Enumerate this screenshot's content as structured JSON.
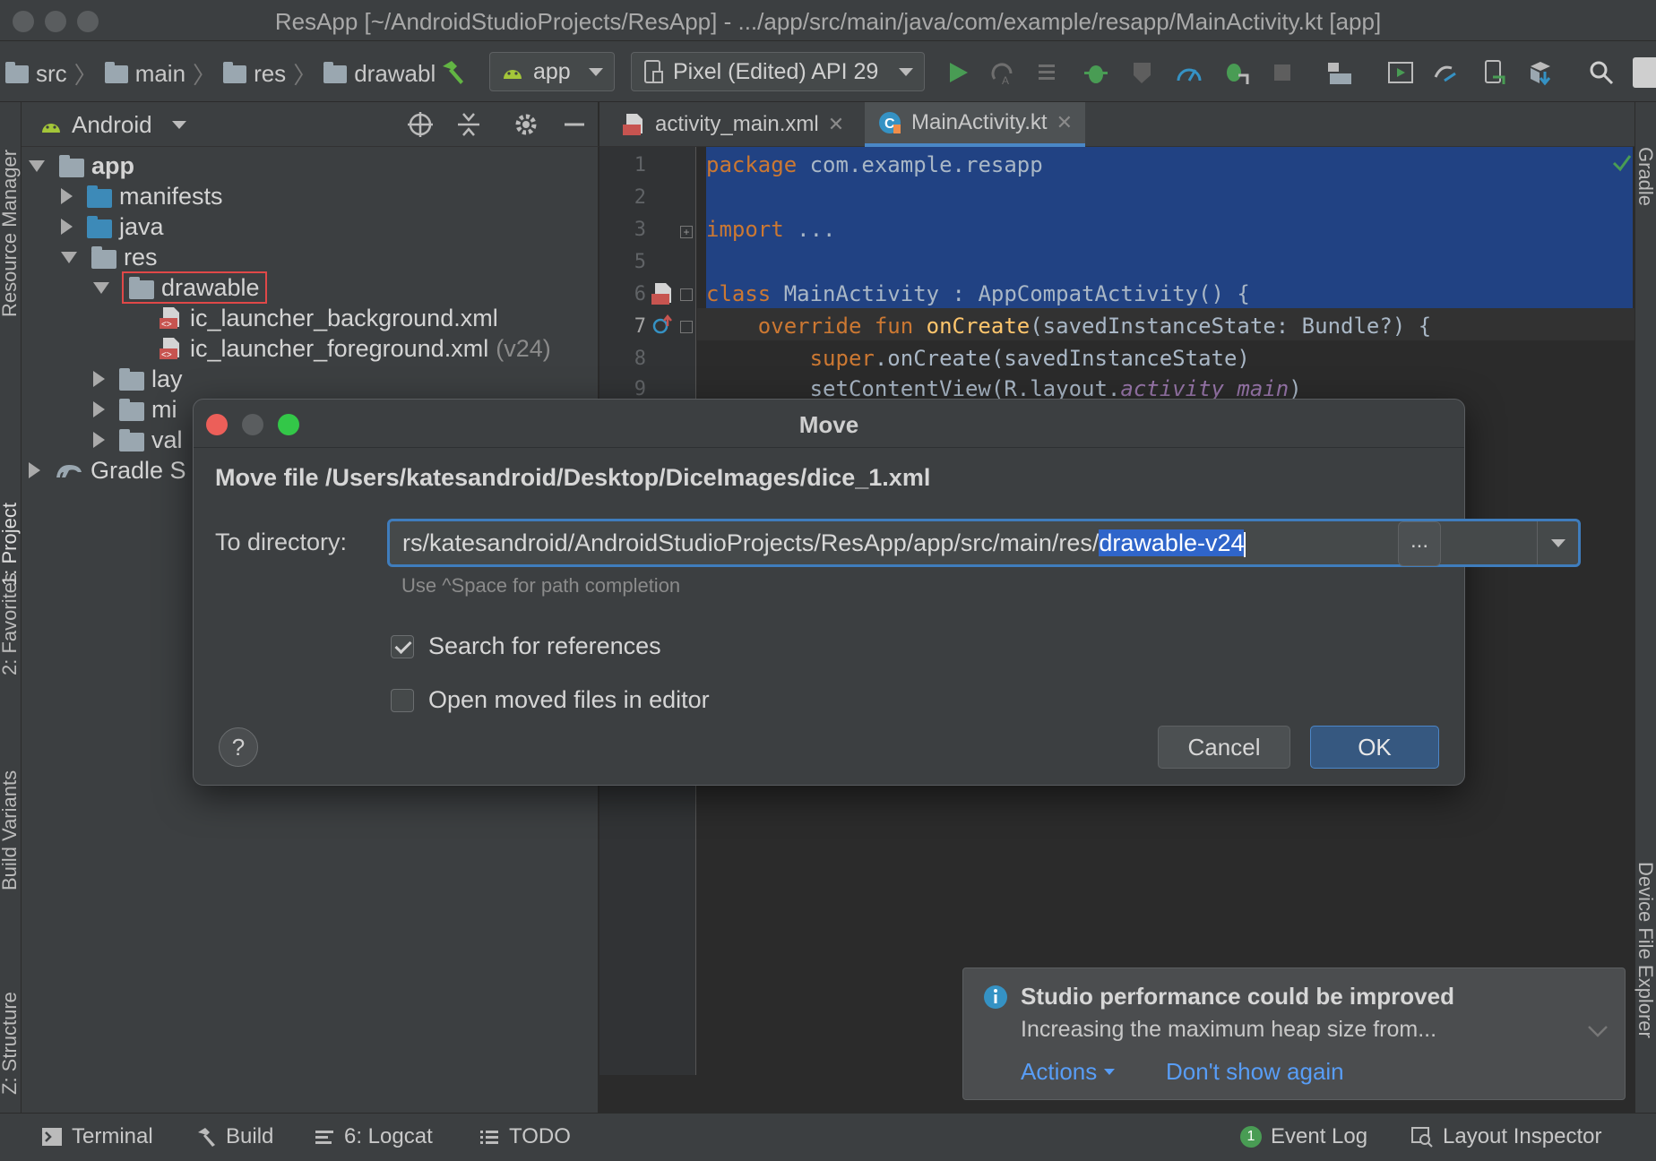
{
  "window": {
    "title": "ResApp [~/AndroidStudioProjects/ResApp] - .../app/src/main/java/com/example/resapp/MainActivity.kt [app]"
  },
  "toolbar": {
    "breadcrumbs": [
      "src",
      "main",
      "res",
      "drawabl"
    ],
    "run_config": "app",
    "device": "Pixel (Edited) API 29"
  },
  "left_strip": [
    "Resource Manager",
    "1: Project",
    "2: Favorites",
    "Build Variants",
    "Z: Structure"
  ],
  "right_strip": [
    "Gradle",
    "Device File Explorer"
  ],
  "project_panel": {
    "view": "Android",
    "tree": {
      "app": "app",
      "manifests": "manifests",
      "java": "java",
      "res": "res",
      "drawable": "drawable",
      "file1": "ic_launcher_background.xml",
      "file2": "ic_launcher_foreground.xml",
      "file2_suffix": "(v24)",
      "layout": "lay",
      "mipmap": "mi",
      "values": "val",
      "gradle": "Gradle S"
    }
  },
  "editor": {
    "tabs": [
      {
        "label": "activity_main.xml"
      },
      {
        "label": "MainActivity.kt"
      }
    ],
    "line_numbers": [
      "1",
      "2",
      "3",
      "5",
      "6",
      "7",
      "8",
      "9"
    ],
    "code": {
      "l1_kw": "package",
      "l1_rest": " com.example.resapp",
      "l3_kw": "import",
      "l3_rest": " ...",
      "l6_kw": "class",
      "l6_rest": " MainActivity : AppCompatActivity() {",
      "l7_kw1": "    override fun",
      "l7_fn": " onCreate",
      "l7_rest": "(savedInstanceState: Bundle?) {",
      "l8_kw": "        super",
      "l8_rest": ".onCreate(savedInstanceState)",
      "l9_a": "        setContentView(R.layout.",
      "l9_it": "activity_main",
      "l9_b": ")"
    }
  },
  "dialog": {
    "title": "Move",
    "message": "Move file /Users/katesandroid/Desktop/DiceImages/dice_1.xml",
    "dir_label": "To directory:",
    "dir_value_plain": "rs/katesandroid/AndroidStudioProjects/ResApp/app/src/main/res/",
    "dir_value_selected": "drawable-v24",
    "browse_label": "...",
    "hint": "Use ^Space for path completion",
    "search_refs": {
      "label": "Search for references",
      "checked": true
    },
    "open_moved": {
      "label": "Open moved files in editor",
      "checked": false
    },
    "help": "?",
    "cancel": "Cancel",
    "ok": "OK"
  },
  "notification": {
    "title": "Studio performance could be improved",
    "body": "Increasing the maximum heap size from...",
    "actions": "Actions",
    "dismiss": "Don't show again"
  },
  "statusbar": {
    "terminal": "Terminal",
    "build": "Build",
    "logcat": "6: Logcat",
    "todo": "TODO",
    "event_badge": "1",
    "event_log": "Event Log",
    "layout_inspector": "Layout Inspector"
  },
  "colors": {
    "accent": "#3f7dbd",
    "selection": "#214283",
    "run_green": "#499c54",
    "link": "#589df6"
  }
}
